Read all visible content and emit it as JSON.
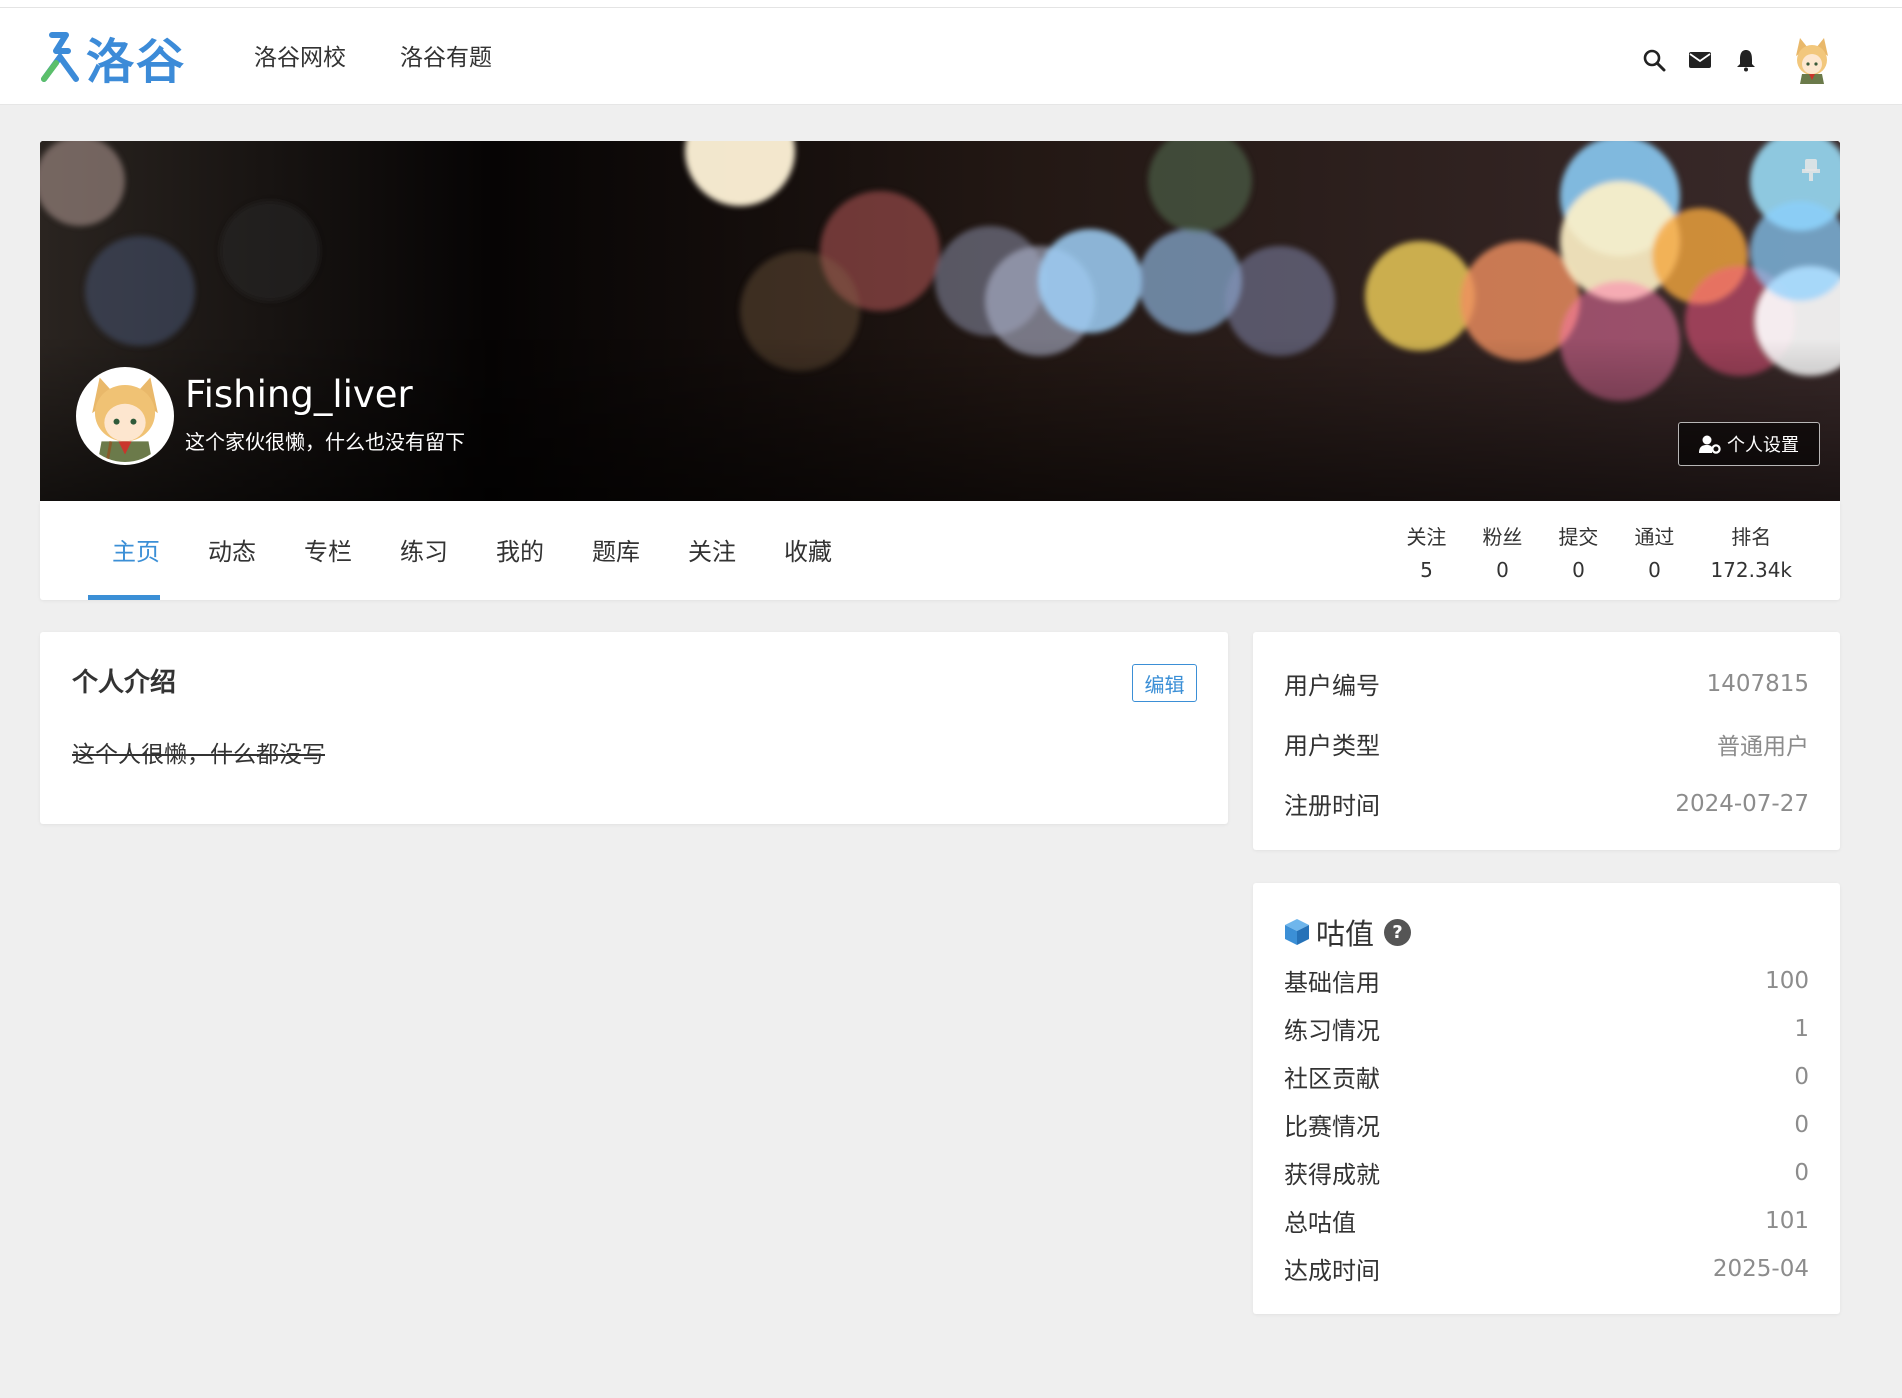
{
  "brand": {
    "name": "洛谷",
    "color": "#3c8bd8"
  },
  "nav": {
    "links": [
      "洛谷网校",
      "洛谷有题"
    ],
    "icons": [
      "search-icon",
      "mail-icon",
      "bell-icon",
      "avatar"
    ]
  },
  "profile": {
    "username": "Fishing_liver",
    "bio": "这个家伙很懒，什么也没有留下",
    "settings_label": "个人设置"
  },
  "tabs": [
    {
      "label": "主页",
      "active": true
    },
    {
      "label": "动态"
    },
    {
      "label": "专栏"
    },
    {
      "label": "练习"
    },
    {
      "label": "我的"
    },
    {
      "label": "题库"
    },
    {
      "label": "关注"
    },
    {
      "label": "收藏"
    }
  ],
  "stats": [
    {
      "label": "关注",
      "value": "5"
    },
    {
      "label": "粉丝",
      "value": "0"
    },
    {
      "label": "提交",
      "value": "0"
    },
    {
      "label": "通过",
      "value": "0"
    },
    {
      "label": "排名",
      "value": "172.34k"
    }
  ],
  "intro": {
    "title": "个人介绍",
    "edit_label": "编辑",
    "text": "这个人很懒，什么都没写"
  },
  "info": [
    {
      "label": "用户编号",
      "value": "1407815"
    },
    {
      "label": "用户类型",
      "value": "普通用户"
    },
    {
      "label": "注册时间",
      "value": "2024-07-27"
    }
  ],
  "score": {
    "title": "咕值",
    "help": "?",
    "rows": [
      {
        "label": "基础信用",
        "value": "100"
      },
      {
        "label": "练习情况",
        "value": "1"
      },
      {
        "label": "社区贡献",
        "value": "0"
      },
      {
        "label": "比赛情况",
        "value": "0"
      },
      {
        "label": "获得成就",
        "value": "0"
      },
      {
        "label": "总咕值",
        "value": "101"
      },
      {
        "label": "达成时间",
        "value": "2025-04"
      }
    ]
  },
  "colors": {
    "accent": "#3b8fd6",
    "background": "#efefef"
  }
}
